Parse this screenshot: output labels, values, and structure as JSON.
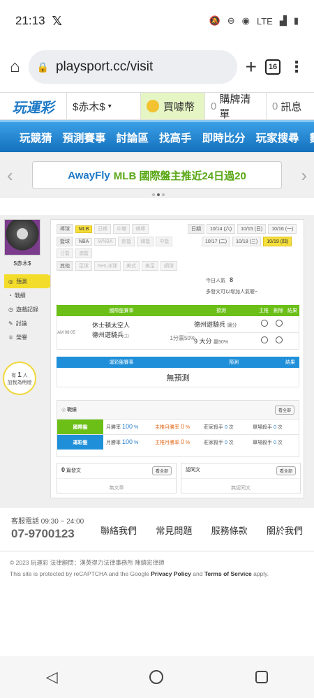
{
  "status": {
    "time": "21:13",
    "network": "LTE"
  },
  "browser": {
    "url": "playsport.cc/visit",
    "tab_count": "16"
  },
  "topnav": {
    "logo": "玩運彩",
    "user": "$赤木$",
    "buy": "買噱幣",
    "list_count": "0",
    "list": "購牌清單",
    "msg_count": "0",
    "msg": "訊息"
  },
  "menu": [
    "玩競猜",
    "預測賽事",
    "討論區",
    "找高手",
    "即時比分",
    "玩家搜尋",
    "數據"
  ],
  "banner": {
    "brand": "AwayFly",
    "text": "MLB 國際盤主推近24日過20"
  },
  "sidebar": {
    "username": "$赤木$",
    "items": [
      "預測",
      "戰績",
      "遊戲記錄",
      "討論",
      "榮譽"
    ],
    "bulb_line1": "有",
    "bulb_count": "1",
    "bulb_unit": "人",
    "bulb_line2": "加我為明燈"
  },
  "filters": {
    "baseball_label": "棒球",
    "baseball": [
      "MLB",
      "日棒",
      "中職",
      "韓棒"
    ],
    "basketball_label": "籃球",
    "basketball": [
      "NBA",
      "WNBA",
      "歐籃",
      "韓籃",
      "中籃",
      "日籃",
      "澳籃"
    ],
    "other_label": "其他",
    "other": [
      "足球",
      "NHL冰球",
      "美式",
      "美足",
      "網球"
    ]
  },
  "dates": {
    "label": "日期",
    "list": [
      "10/14 (六)",
      "10/15 (日)",
      "10/16 (一)",
      "10/17 (二)",
      "10/18 (三)",
      "10/19 (四)"
    ]
  },
  "popularity": {
    "label": "今日人氣",
    "value": "8",
    "hint": "多發文可以增加人氣喔~"
  },
  "intl": {
    "headers": [
      "國際盤賽事",
      "預測",
      "主推",
      "刪除",
      "結果"
    ],
    "time": "AM 08:05",
    "team1": "休士頓太空人",
    "team2": "德州遊騎兵",
    "team2_tag": "(主)",
    "line": "1分贏50%",
    "pick1_team": "德州遊騎兵",
    "pick1_type": "讓分",
    "pick2_team": "9 大分",
    "pick2_type": "贏50%"
  },
  "lottery": {
    "headers": [
      "運彩盤賽事",
      "預測",
      "結果"
    ],
    "empty": "無預測"
  },
  "record": {
    "title": "戰績",
    "view_all": "看全部",
    "rows": [
      {
        "label": "國際盤",
        "win": "月勝率",
        "win_val": "100",
        "main": "主推月勝率",
        "main_val": "0",
        "kill": "莊家殺手",
        "kill_val": "0",
        "single": "單場殺手",
        "single_val": "0"
      },
      {
        "label": "運彩盤",
        "win": "月勝率",
        "win_val": "100",
        "main": "主推月勝率",
        "main_val": "0",
        "kill": "莊家殺手",
        "kill_val": "0",
        "single": "單場殺手",
        "single_val": "0"
      }
    ]
  },
  "posts": {
    "count": "0",
    "label": "篇發文",
    "view_all": "看全部",
    "empty": "無文章",
    "reply_label": "認同文",
    "reply_empty": "無認同文"
  },
  "footer": {
    "phone_label": "客服電話 09:30 ~ 24:00",
    "phone": "07-9700123",
    "links": [
      "聯絡我們",
      "常見問題",
      "服務條款",
      "關於我們"
    ],
    "copyright": "© 2023 玩運彩 法律顧問：漢英得力法律事務所 陳鎮宏律師",
    "captcha_pre": "This site is protected by reCAPTCHA and the Google",
    "privacy": "Privacy Policy",
    "and": "and",
    "terms": "Terms of Service",
    "apply": "apply."
  },
  "colors": {
    "green": "#6bbf17",
    "blue": "#1e8fd8",
    "yellow": "#f6df3b"
  }
}
